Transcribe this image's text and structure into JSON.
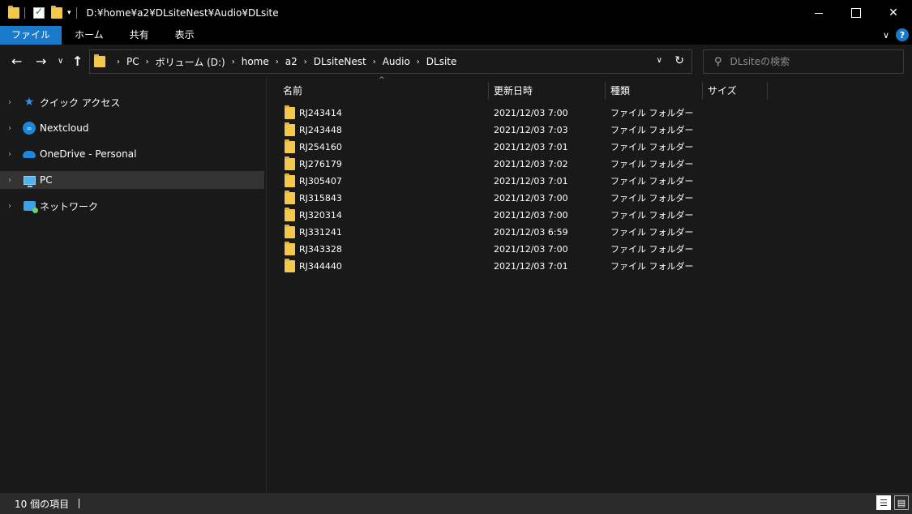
{
  "window": {
    "title": "D:¥home¥a2¥DLsiteNest¥Audio¥DLsite",
    "minimize_glyph": "",
    "maximize_glyph": "",
    "close_glyph": "✕"
  },
  "quick_access_toolbar": {
    "dropdown_glyph": "▾"
  },
  "ribbon": {
    "tabs": [
      {
        "label": "ファイル",
        "active": true
      },
      {
        "label": "ホーム",
        "active": false
      },
      {
        "label": "共有",
        "active": false
      },
      {
        "label": "表示",
        "active": false
      }
    ],
    "expand_glyph": "∨",
    "help_glyph": "?"
  },
  "navigation": {
    "back_glyph": "←",
    "forward_glyph": "→",
    "recent_glyph": "∨",
    "up_glyph": "↑"
  },
  "address_bar": {
    "breadcrumbs": [
      "PC",
      "ボリューム (D:)",
      "home",
      "a2",
      "DLsiteNest",
      "Audio",
      "DLsite"
    ],
    "separator_glyph": "›",
    "dropdown_glyph": "∨",
    "refresh_glyph": "↻"
  },
  "search": {
    "placeholder": "DLsiteの検索",
    "value": "",
    "icon_glyph": "⚲"
  },
  "nav_pane": {
    "chevron_glyph": "›",
    "items": [
      {
        "label": "クイック アクセス",
        "icon": "star-icon",
        "selected": false
      },
      {
        "label": "Nextcloud",
        "icon": "nextcloud-icon",
        "selected": false
      },
      {
        "label": "OneDrive - Personal",
        "icon": "cloud-icon",
        "selected": false
      },
      {
        "label": "PC",
        "icon": "computer-icon",
        "selected": true
      },
      {
        "label": "ネットワーク",
        "icon": "network-icon",
        "selected": false
      }
    ],
    "nextcloud_glyph": "∞",
    "star_glyph": "★"
  },
  "file_list": {
    "sort_glyph": "^",
    "columns": {
      "name": "名前",
      "date": "更新日時",
      "type": "種類",
      "size": "サイズ"
    },
    "rows": [
      {
        "name": "RJ243414",
        "date": "2021/12/03 7:00",
        "type": "ファイル フォルダー"
      },
      {
        "name": "RJ243448",
        "date": "2021/12/03 7:03",
        "type": "ファイル フォルダー"
      },
      {
        "name": "RJ254160",
        "date": "2021/12/03 7:01",
        "type": "ファイル フォルダー"
      },
      {
        "name": "RJ276179",
        "date": "2021/12/03 7:02",
        "type": "ファイル フォルダー"
      },
      {
        "name": "RJ305407",
        "date": "2021/12/03 7:01",
        "type": "ファイル フォルダー"
      },
      {
        "name": "RJ315843",
        "date": "2021/12/03 7:00",
        "type": "ファイル フォルダー"
      },
      {
        "name": "RJ320314",
        "date": "2021/12/03 7:00",
        "type": "ファイル フォルダー"
      },
      {
        "name": "RJ331241",
        "date": "2021/12/03 6:59",
        "type": "ファイル フォルダー"
      },
      {
        "name": "RJ343328",
        "date": "2021/12/03 7:00",
        "type": "ファイル フォルダー"
      },
      {
        "name": "RJ344440",
        "date": "2021/12/03 7:01",
        "type": "ファイル フォルダー"
      }
    ]
  },
  "status_bar": {
    "item_count": "10 個の項目",
    "details_view_glyph": "☰",
    "tiles_view_glyph": "▤"
  },
  "colors": {
    "accent": "#1979ca",
    "folder": "#f2c94c",
    "background": "#191919",
    "selection": "#333333"
  }
}
